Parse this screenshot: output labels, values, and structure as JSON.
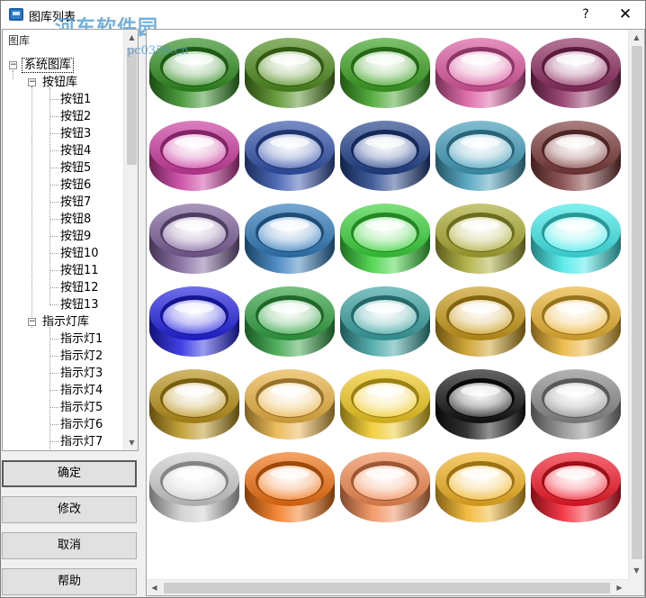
{
  "window": {
    "title": "图库列表",
    "help_label": "?",
    "close_label": "✕",
    "watermark": "河东软件园",
    "watermark_url": "pc0359.cn"
  },
  "tree": {
    "header": "图库",
    "root": {
      "label": "系统图库",
      "expander": "−"
    },
    "button_lib": {
      "label": "按钮库",
      "expander": "−",
      "items": [
        "按钮1",
        "按钮2",
        "按钮3",
        "按钮4",
        "按钮5",
        "按钮6",
        "按钮7",
        "按钮8",
        "按钮9",
        "按钮10",
        "按钮11",
        "按钮12",
        "按钮13"
      ]
    },
    "indicator_lib": {
      "label": "指示灯库",
      "expander": "−",
      "items": [
        "指示灯1",
        "指示灯2",
        "指示灯3",
        "指示灯4",
        "指示灯5",
        "指示灯6",
        "指示灯7"
      ]
    }
  },
  "actions": {
    "ok": "确定",
    "modify": "修改",
    "cancel": "取消",
    "help": "帮助"
  },
  "scroll": {
    "up": "▲",
    "down": "▼",
    "left": "◀",
    "right": "▶"
  },
  "gallery": {
    "colors": [
      "#2e8b1e",
      "#4d8a1c",
      "#3aa020",
      "#d8559c",
      "#8b2a5e",
      "#c8389c",
      "#2f50a8",
      "#1f3f88",
      "#3f9ab8",
      "#7a3838",
      "#7a5e98",
      "#2e78b8",
      "#38d038",
      "#a8a830",
      "#40e8e8",
      "#2020e0",
      "#30a040",
      "#38a0a0",
      "#c89818",
      "#e8b030",
      "#b89018",
      "#e8b040",
      "#f0c820",
      "#101010",
      "#888888",
      "#cccccc",
      "#f07010",
      "#f08850",
      "#f0b020",
      "#f01828"
    ]
  }
}
